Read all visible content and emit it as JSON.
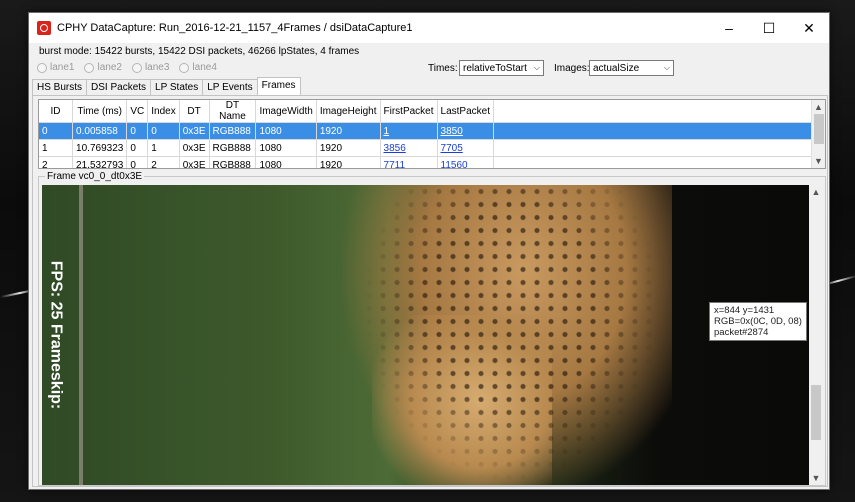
{
  "window": {
    "title": "CPHY DataCapture: Run_2016-12-21_1157_4Frames / dsiDataCapture1",
    "controls": [
      "–",
      "☐",
      "✕"
    ]
  },
  "info": "burst mode: 15422 bursts, 15422 DSI packets, 46266 lpStates, 4 frames",
  "lanes": [
    "lane1",
    "lane2",
    "lane3",
    "lane4"
  ],
  "times": {
    "label": "Times:",
    "value": "relativeToStart"
  },
  "images": {
    "label": "Images:",
    "value": "actualSize"
  },
  "tabs": [
    {
      "label": "HS Bursts",
      "active": false
    },
    {
      "label": "DSI Packets",
      "active": false
    },
    {
      "label": "LP States",
      "active": false
    },
    {
      "label": "LP Events",
      "active": false
    },
    {
      "label": "Frames",
      "active": true
    }
  ],
  "table": {
    "columns": [
      "ID",
      "Time (ms)",
      "VC",
      "Index",
      "DT",
      "DT Name",
      "ImageWidth",
      "ImageHeight",
      "FirstPacket",
      "LastPacket"
    ],
    "rows": [
      {
        "cells": [
          "0",
          "0.005858",
          "0",
          "0",
          "0x3E",
          "RGB888",
          "1080",
          "1920",
          "1",
          "3850"
        ],
        "selected": true
      },
      {
        "cells": [
          "1",
          "10.769323",
          "0",
          "1",
          "0x3E",
          "RGB888",
          "1080",
          "1920",
          "3856",
          "7705"
        ],
        "selected": false
      },
      {
        "cells": [
          "2",
          "21.532793",
          "0",
          "2",
          "0x3E",
          "RGB888",
          "1080",
          "1920",
          "7711",
          "11560"
        ],
        "selected": false
      }
    ]
  },
  "frame": {
    "label": "Frame vc0_0_dt0x3E",
    "overlay": "FPS: 25  Frameskip:",
    "tooltip": [
      "x=844 y=1431",
      "RGB=0x(0C, 0D, 08)",
      "packet#2874"
    ]
  }
}
